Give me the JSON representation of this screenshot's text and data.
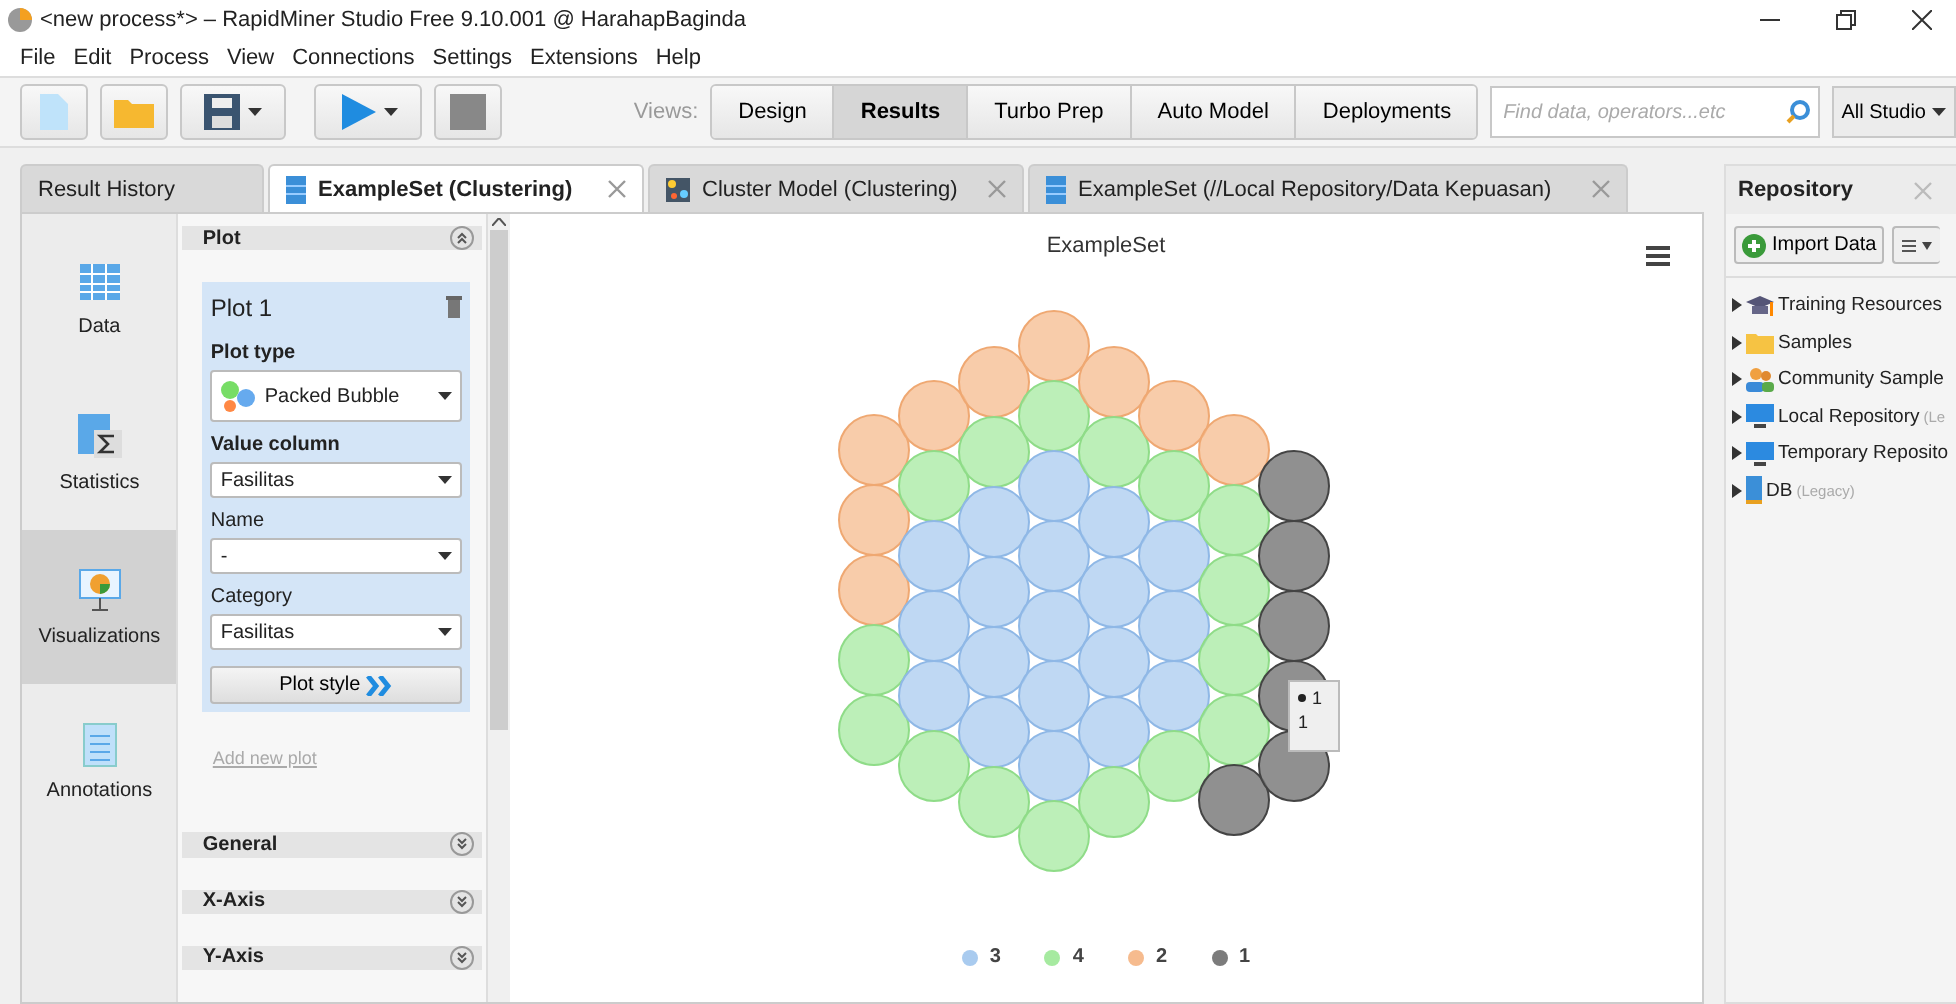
{
  "window": {
    "title": "<new process*> – RapidMiner Studio Free 9.10.001 @ HarahapBaginda"
  },
  "menu": [
    "File",
    "Edit",
    "Process",
    "View",
    "Connections",
    "Settings",
    "Extensions",
    "Help"
  ],
  "toolbar": {
    "views_label": "Views:",
    "views": [
      {
        "label": "Design",
        "selected": false
      },
      {
        "label": "Results",
        "selected": true
      },
      {
        "label": "Turbo Prep",
        "selected": false
      },
      {
        "label": "Auto Model",
        "selected": false
      },
      {
        "label": "Deployments",
        "selected": false
      }
    ],
    "search": {
      "placeholder": "Find data, operators...etc"
    },
    "scope": "All Studio"
  },
  "tabs": [
    {
      "label": "Result History",
      "kind": "plain",
      "selected": false,
      "closable": false
    },
    {
      "label": "ExampleSet (Clustering)",
      "kind": "table",
      "selected": true,
      "closable": true
    },
    {
      "label": "Cluster Model (Clustering)",
      "kind": "model",
      "selected": false,
      "closable": true
    },
    {
      "label": "ExampleSet (//Local Repository/Data Kepuasan)",
      "kind": "table",
      "selected": false,
      "closable": true
    }
  ],
  "side_nav": [
    {
      "label": "Data",
      "kind": "data",
      "selected": false
    },
    {
      "label": "Statistics",
      "kind": "statistics",
      "selected": false
    },
    {
      "label": "Visualizations",
      "kind": "visualizations",
      "selected": true
    },
    {
      "label": "Annotations",
      "kind": "annotations",
      "selected": false
    }
  ],
  "plot_panel": {
    "title": "Plot",
    "plot": {
      "title": "Plot 1",
      "fields": [
        {
          "label": "Plot type",
          "bold": true,
          "value": "Packed Bubble",
          "kind": "bubble"
        },
        {
          "label": "Value column",
          "bold": true,
          "value": "Fasilitas",
          "kind": "plain"
        },
        {
          "label": "Name",
          "bold": false,
          "value": "-",
          "kind": "plain"
        },
        {
          "label": "Category",
          "bold": false,
          "value": "Fasilitas",
          "kind": "plain"
        }
      ],
      "style_button": "Plot style"
    },
    "add_link": "Add new plot",
    "sections": [
      "General",
      "X-Axis",
      "Y-Axis"
    ]
  },
  "chart": {
    "title": "ExampleSet",
    "legend": [
      {
        "label": "3",
        "color": "#a9cbef"
      },
      {
        "label": "4",
        "color": "#a6eaa0"
      },
      {
        "label": "2",
        "color": "#f6bb8e"
      },
      {
        "label": "1",
        "color": "#7c7c7c"
      }
    ],
    "tooltip": {
      "series": "1",
      "value": "1"
    }
  },
  "repository": {
    "title": "Repository",
    "import_button": "Import Data",
    "items": [
      {
        "label": "Training Resources",
        "kind": "training"
      },
      {
        "label": "Samples",
        "kind": "folder"
      },
      {
        "label": "Community Sample",
        "kind": "community"
      },
      {
        "label": "Local Repository",
        "kind": "monitor",
        "suffix": "(Le"
      },
      {
        "label": "Temporary Reposito",
        "kind": "monitor"
      },
      {
        "label": "DB",
        "kind": "db",
        "suffix": "(Legacy)"
      }
    ]
  }
}
